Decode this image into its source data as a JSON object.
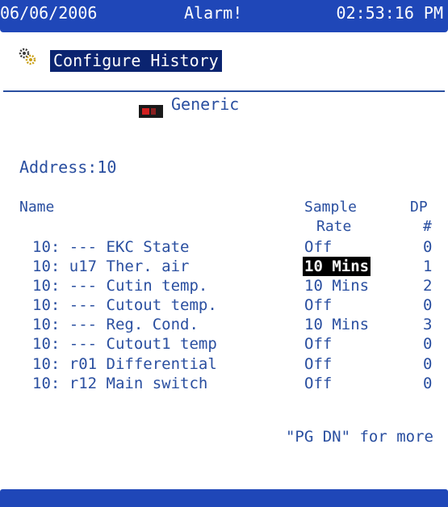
{
  "status_bar": {
    "date": "06/06/2006",
    "alarm": "Alarm!",
    "time": "02:53:16 PM"
  },
  "title": {
    "icon": "gear-icon",
    "text": "Configure History"
  },
  "device": {
    "icon": "controller-icon",
    "label": "Generic"
  },
  "address": "Address:10",
  "table": {
    "headers": {
      "name": "Name",
      "sample_rate_line1": "Sample",
      "sample_rate_line2": "Rate",
      "dp_line1": "DP",
      "dp_line2": "#"
    },
    "rows": [
      {
        "name": "10: --- EKC State",
        "rate": "Off",
        "dp": "0"
      },
      {
        "name": "10: u17 Ther. air",
        "rate": "10 Mins",
        "dp": "1"
      },
      {
        "name": "10: --- Cutin temp.",
        "rate": "10 Mins",
        "dp": "2"
      },
      {
        "name": "10: --- Cutout temp.",
        "rate": "Off",
        "dp": "0"
      },
      {
        "name": "10: --- Reg. Cond.",
        "rate": "10 Mins",
        "dp": "3"
      },
      {
        "name": "10: --- Cutout1 temp",
        "rate": "Off",
        "dp": "0"
      },
      {
        "name": "10: r01 Differential",
        "rate": "Off",
        "dp": "0"
      },
      {
        "name": "10: r12 Main switch",
        "rate": "Off",
        "dp": "0"
      }
    ],
    "selected_row": 1
  },
  "hint": "\"PG DN\" for more",
  "colors": {
    "bar_blue": "#1f47b8",
    "text_blue": "#2a4fa0",
    "title_bg": "#0b2470"
  }
}
